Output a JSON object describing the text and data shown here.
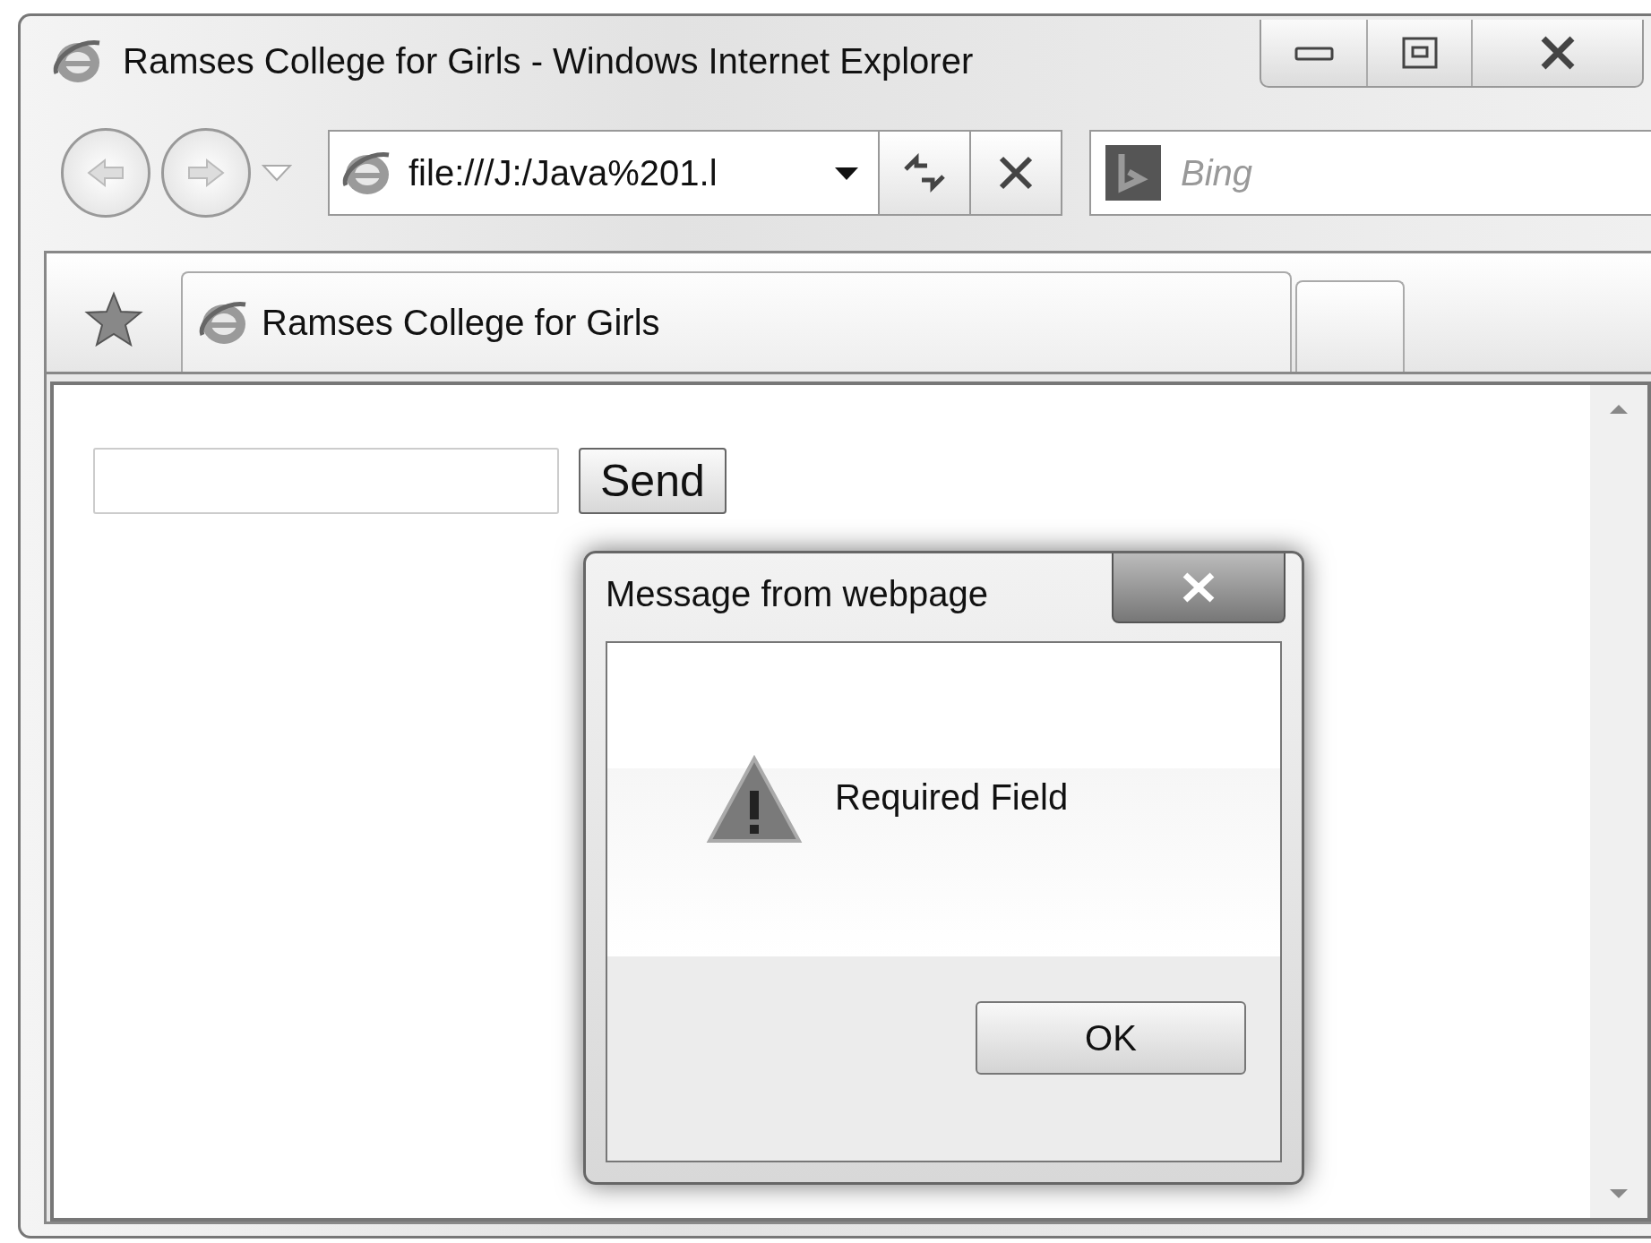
{
  "window": {
    "title": "Ramses College for Girls - Windows Internet Explorer"
  },
  "address_bar": {
    "value": "file:///J:/Java%201.l"
  },
  "search": {
    "placeholder": "Bing"
  },
  "tabs": [
    {
      "label": "Ramses College for Girls",
      "selected": true
    }
  ],
  "page": {
    "button": "Send"
  },
  "dialog": {
    "title": "Message from webpage",
    "message": "Required Field",
    "buttons": [
      "OK"
    ]
  }
}
